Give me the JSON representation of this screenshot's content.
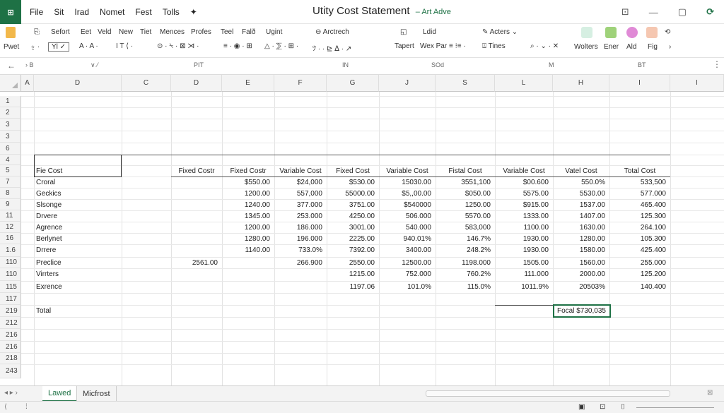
{
  "app": {
    "icon_text": "⊞",
    "title": "Utity Cost Statement",
    "title_suffix": "Art Adve",
    "accent": "#1e7145"
  },
  "menu": [
    "File",
    "Sit",
    "Irad",
    "Nomet",
    "Fest",
    "Tolls",
    "✦"
  ],
  "window_controls": [
    "⊡",
    "—",
    "▢",
    "⟳"
  ],
  "ribbon": {
    "paste_label": "Pwet",
    "row1": [
      "Sefort",
      "Eet",
      "Veld",
      "New",
      "Tiet",
      "Mences",
      "Profes",
      "Teel",
      "Falð",
      "Ugint",
      "Arctrech",
      "Ldid",
      "Acters",
      "Wolters",
      "Ener",
      "Ald",
      "Fig"
    ],
    "row2": [
      "Tapert",
      "Wex Par",
      "Tines"
    ],
    "right_labels": [
      "Wolters",
      "Ener",
      "Ald",
      "Fig"
    ]
  },
  "formula_bar": {
    "name_box": "B",
    "labels": [
      "PIT",
      "IN",
      "SOd",
      "M",
      "BT"
    ]
  },
  "columns": [
    "A",
    "D",
    "C",
    "D",
    "E",
    "F",
    "G",
    "J",
    "S",
    "L",
    "H",
    "I",
    "I"
  ],
  "rows": [
    "1",
    "2",
    "3",
    "3",
    "6",
    "4",
    "5",
    "7",
    "8",
    "9",
    "11",
    "12",
    "16",
    "1.6",
    "110",
    "110",
    "115",
    "117",
    "219",
    "212",
    "216",
    "216",
    "218",
    "243"
  ],
  "table": {
    "header_label": "Fie Cost",
    "headers": [
      "Fixed Costr",
      "Fixed Costr",
      "Variable Cost",
      "Fixed Cost",
      "Variable Cost",
      "Fistal Cost",
      "Variable Cost",
      "Vatel Cost",
      "Total Cost"
    ],
    "rows": [
      {
        "label": "Croral",
        "values": [
          "",
          "$550.00",
          "$24,000",
          "$530.00",
          "15030.00",
          "3551,100",
          "$00.600",
          "550.0%",
          "533,500"
        ]
      },
      {
        "label": "Geckics",
        "values": [
          "",
          "1200.00",
          "557,000",
          "55000.00",
          "$5,,00.00",
          "$050.00",
          "5575.00",
          "5530.00",
          "577.000"
        ]
      },
      {
        "label": "Slsonge",
        "values": [
          "",
          "1240.00",
          "377.000",
          "3751.00",
          "$540000",
          "1250.00",
          "$915.00",
          "1537.00",
          "465.400"
        ]
      },
      {
        "label": "Drvere",
        "values": [
          "",
          "1345.00",
          "253.000",
          "4250.00",
          "506.000",
          "5570.00",
          "1333.00",
          "1407.00",
          "125.300"
        ]
      },
      {
        "label": "Agrence",
        "values": [
          "",
          "1200.00",
          "186.000",
          "3001.00",
          "540.000",
          "583,000",
          "1100.00",
          "1630.00",
          "264.100"
        ]
      },
      {
        "label": "Berlynet",
        "values": [
          "",
          "1280.00",
          "196.000",
          "2225.00",
          "940.01%",
          "146.7%",
          "1930.00",
          "1280.00",
          "105.300"
        ]
      },
      {
        "label": "Drrere",
        "values": [
          "",
          "1140.00",
          "733.0%",
          "7392.00",
          "3400.00",
          "248.2%",
          "1930.00",
          "1580.00",
          "425.400"
        ]
      },
      {
        "label": "Preclice",
        "values": [
          "2561.00",
          "",
          "266.900",
          "2550.00",
          "12500.00",
          "1198.000",
          "1505.00",
          "1560.00",
          "255.000"
        ]
      },
      {
        "label": "Virrters",
        "values": [
          "",
          "",
          "",
          "1215.00",
          "752.000",
          "760.2%",
          "111.000",
          "2000.00",
          "125.200"
        ]
      },
      {
        "label": "Exrence",
        "values": [
          "",
          "",
          "",
          "1197.06",
          "101.0%",
          "115.0%",
          "1011.9%",
          "20503%",
          "140.400"
        ]
      }
    ],
    "total_label": "Total",
    "total_value": "Focal $730,035"
  },
  "sheet_tabs": [
    "Lawed",
    "Micfrost"
  ],
  "status": {
    "left": "⟨",
    "icons": [
      "▣",
      "⊡",
      "⌷"
    ]
  }
}
